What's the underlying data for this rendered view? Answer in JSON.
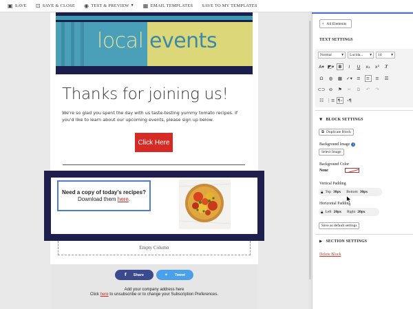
{
  "toolbar": {
    "save": "SAVE",
    "save_close": "SAVE & CLOSE",
    "test_preview": "TEST & PREVIEW",
    "email_templates": "EMAIL TEMPLATES",
    "save_templates": "SAVE TO MY TEMPLATES"
  },
  "email": {
    "banner_word1": "local",
    "banner_word2": "events",
    "heading": "Thanks for joining us!",
    "intro": "We're so glad you spent the day with us taste-testing yummy tomato recipes. If you'd like to learn about our upcoming events, please sign up below.",
    "cta": "Click Here",
    "recipe_line1": "Need a copy of today's recipes?",
    "recipe_line2_prefix": "Download them ",
    "recipe_link": "here",
    "recipe_line2_suffix": ".",
    "empty_column": "Empty Column",
    "share": "Share",
    "tweet": "Tweet",
    "address": "Add your company address here",
    "footer_prefix": "Click ",
    "footer_link": "here",
    "footer_suffix": " to unsubscribe or to change your Subscription Preferences."
  },
  "panel": {
    "all_elements": "All Elements",
    "text_settings": "TEXT SETTINGS",
    "format": "Normal",
    "font": "Lucida...",
    "size": "14",
    "block_settings": "BLOCK SETTINGS",
    "duplicate": "Duplicate Block",
    "bg_image": "Background Image",
    "select_image": "Select Image",
    "bg_color": "Background Color",
    "bg_color_value": "None",
    "vertical_padding": "Vertical Padding",
    "top_label": "Top",
    "top_value": "30px",
    "bottom_label": "Bottom",
    "bottom_value": "30px",
    "horizontal_padding": "Horizontal Padding",
    "left_label": "Left",
    "left_value": "20px",
    "right_label": "Right",
    "right_value": "20px",
    "save_default": "Save as default settings",
    "section_settings": "SECTION SETTINGS",
    "delete_block": "Delete Block"
  },
  "colors": {
    "accent_blue": "#4a74c9",
    "cta_red": "#d62a24",
    "block_navy": "#1e1f4d",
    "banner_yellow": "#dcd879",
    "banner_teal": "#4a9fb9",
    "facebook": "#3b4a8e",
    "twitter": "#4aa1e8"
  },
  "icons": [
    "save-icon",
    "save-close-icon",
    "eye-icon",
    "templates-icon",
    "chevron-left-icon",
    "lock-icon",
    "flag-icon",
    "link-icon",
    "image-icon",
    "info-icon",
    "facebook-icon",
    "twitter-icon"
  ]
}
